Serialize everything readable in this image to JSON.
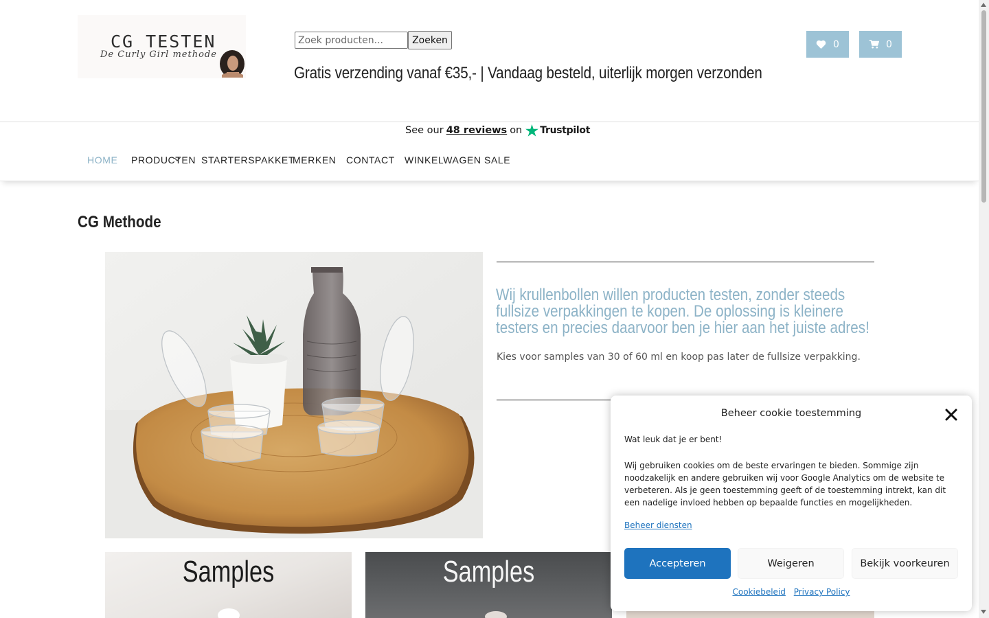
{
  "header": {
    "logo_title": "CG TESTEN",
    "logo_subtitle": "De Curly Girl methode",
    "search": {
      "placeholder": "Zoek producten...",
      "button_label": "Zoeken"
    },
    "tagline": "Gratis verzending vanaf €35,- | Vandaag besteld, uiterlijk morgen verzonden",
    "wishlist": {
      "icon": "heart-icon",
      "count": "0"
    },
    "cart": {
      "icon": "cart-icon",
      "count": "0"
    },
    "accent_color": "#9dc3d6"
  },
  "trustpilot": {
    "prefix": "See our",
    "reviews": "48 reviews",
    "on": "on",
    "brand": "Trustpilot",
    "star_color": "#00b67a"
  },
  "nav": {
    "items": [
      {
        "label": "HOME",
        "active": true
      },
      {
        "label": "PRODUCTEN",
        "has_dropdown": true
      },
      {
        "label": "STARTERSPAKKET"
      },
      {
        "label": "MERKEN"
      },
      {
        "label": "CONTACT"
      },
      {
        "label": "WINKELWAGEN"
      },
      {
        "label": "SALE"
      }
    ]
  },
  "main": {
    "page_title": "CG Methode",
    "intro_heading": "Wij krullenbollen willen producten testen, zonder steeds fullsize verpakkingen te kopen. De oplossing is kleinere testers en precies daarvoor ben je hier aan het juiste adres!",
    "intro_text": "Kies voor samples van 30 of 60 ml en koop pas later de fullsize verpakking.",
    "tiles": [
      {
        "label": "Samples"
      },
      {
        "label": "Samples"
      },
      {
        "label": ""
      }
    ]
  },
  "cookie": {
    "title": "Beheer cookie toestemming",
    "greeting": "Wat leuk dat je er bent!",
    "body": "Wij gebruiken cookies om de beste ervaringen te bieden. Sommige zijn noodzakelijk en andere gebruiken wij voor Google Analytics om de website te verbeteren. Als je geen toestemming geeft of de toestemming intrekt, kan dit een nadelige invloed hebben op bepaalde functies en mogelijkheden.",
    "manage_link": "Beheer diensten",
    "accept": "Accepteren",
    "deny": "Weigeren",
    "preferences": "Bekijk voorkeuren",
    "cookie_policy": "Cookiebeleid",
    "privacy_policy": "Privacy Policy",
    "primary_color": "#1e73be"
  }
}
